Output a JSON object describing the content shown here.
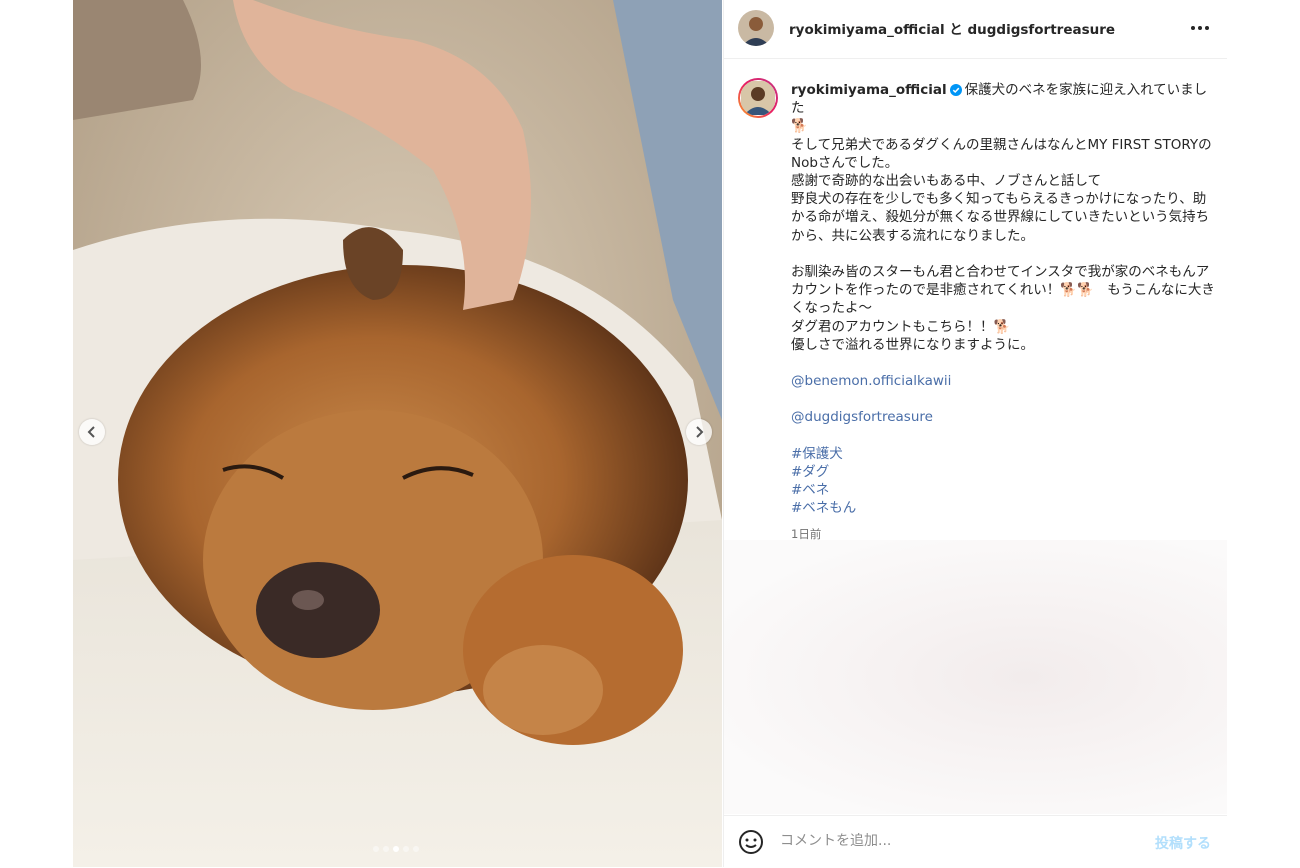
{
  "post": {
    "header": {
      "author": "ryokimiyama_official",
      "connector": "と",
      "collaborator": "dugdigsfortreasure",
      "more_icon": "more-horizontal-icon"
    },
    "media": {
      "description_icon": "photo-dog-sleeping",
      "prev_icon": "chevron-left-icon",
      "next_icon": "chevron-right-icon",
      "slide_count": 5,
      "active_slide": 3
    },
    "caption": {
      "username": "ryokimiyama_official",
      "verified": true,
      "paragraph1": "保護犬のベネを家族に迎え入れていました\n🐕\nそして兄弟犬であるダグくんの里親さんはなんとMY FIRST STORYのNobさんでした。\n感謝で奇跡的な出会いもある中、ノブさんと話して\n野良犬の存在を少しでも多く知ってもらえるきっかけになったり、助かる命が増え、殺処分が無くなる世界線にしていきたいという気持ちから、共に公表する流れになりました。",
      "paragraph2": "お馴染み皆のスターもん君と合わせてインスタで我が家のベネもんアカウントを作ったので是非癒されてくれい！🐕🐕　もうこんなに大きくなったよ〜\nダグ君のアカウントもこちら！！🐕\n優しさで溢れる世界になりますように。",
      "mention1": "@benemon.officialkawii",
      "mention2": "@dugdigsfortreasure",
      "hashtags": [
        "#保護犬",
        "#ダグ",
        "#ベネ",
        "#ベネもん"
      ],
      "time": "1日前"
    },
    "comment_box": {
      "placeholder": "コメントを追加...",
      "submit_label": "投稿する",
      "emoji_icon": "smiley-icon"
    }
  }
}
